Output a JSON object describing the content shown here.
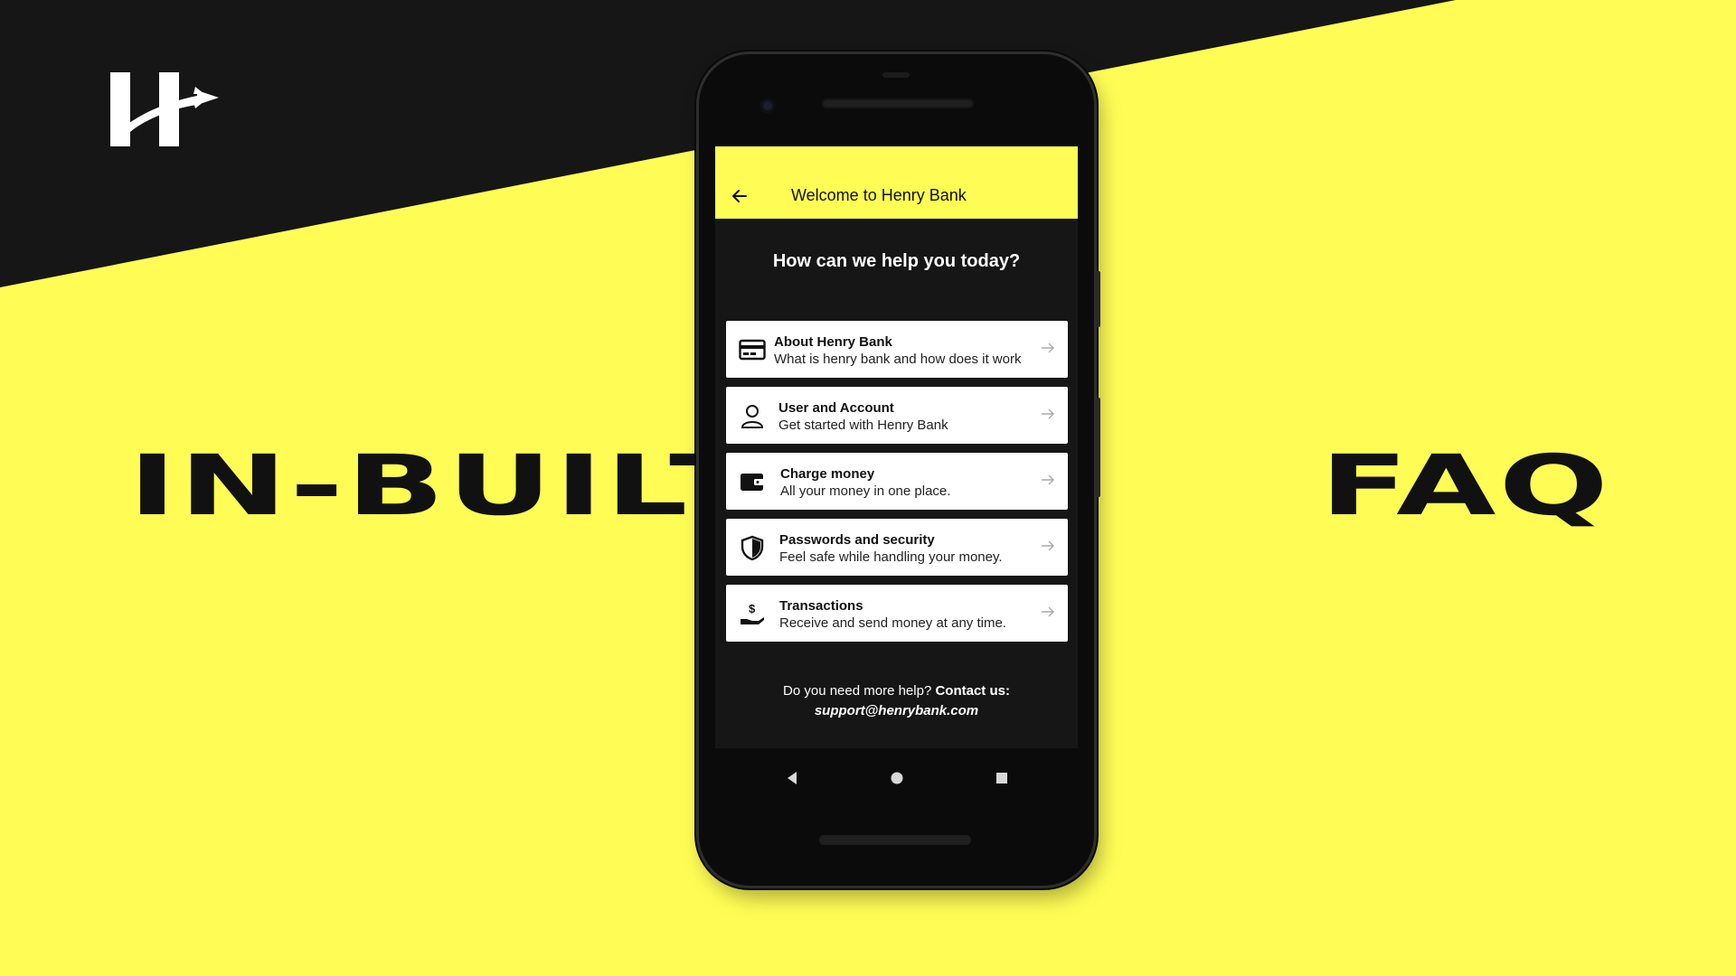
{
  "colors": {
    "accent_yellow": "#FFFD55",
    "dark": "#161616",
    "card": "#FFFFFF",
    "text_dark": "#111111"
  },
  "brand": {
    "logo": "henry-bank-logo-icon"
  },
  "promo": {
    "left_text": "IN-BUILT",
    "right_text": "FAQ"
  },
  "app": {
    "title": "Welcome to Henry Bank",
    "heading": "How can we help you today?",
    "items": [
      {
        "icon": "card-icon",
        "title": "About Henry Bank",
        "subtitle": "What is henry bank and how does it work"
      },
      {
        "icon": "user-icon",
        "title": "User and Account",
        "subtitle": "Get started with Henry Bank"
      },
      {
        "icon": "wallet-icon",
        "title": "Charge money",
        "subtitle": "All your money in one place."
      },
      {
        "icon": "shield-icon",
        "title": "Passwords and security",
        "subtitle": "Feel safe while handling your money."
      },
      {
        "icon": "dollar-hand-icon",
        "title": "Transactions",
        "subtitle": "Receive and send money at any time."
      }
    ],
    "footer": {
      "prefix": "Do you need more help?",
      "contact_label": "Contact us:",
      "email": "support@henrybank.com"
    }
  }
}
